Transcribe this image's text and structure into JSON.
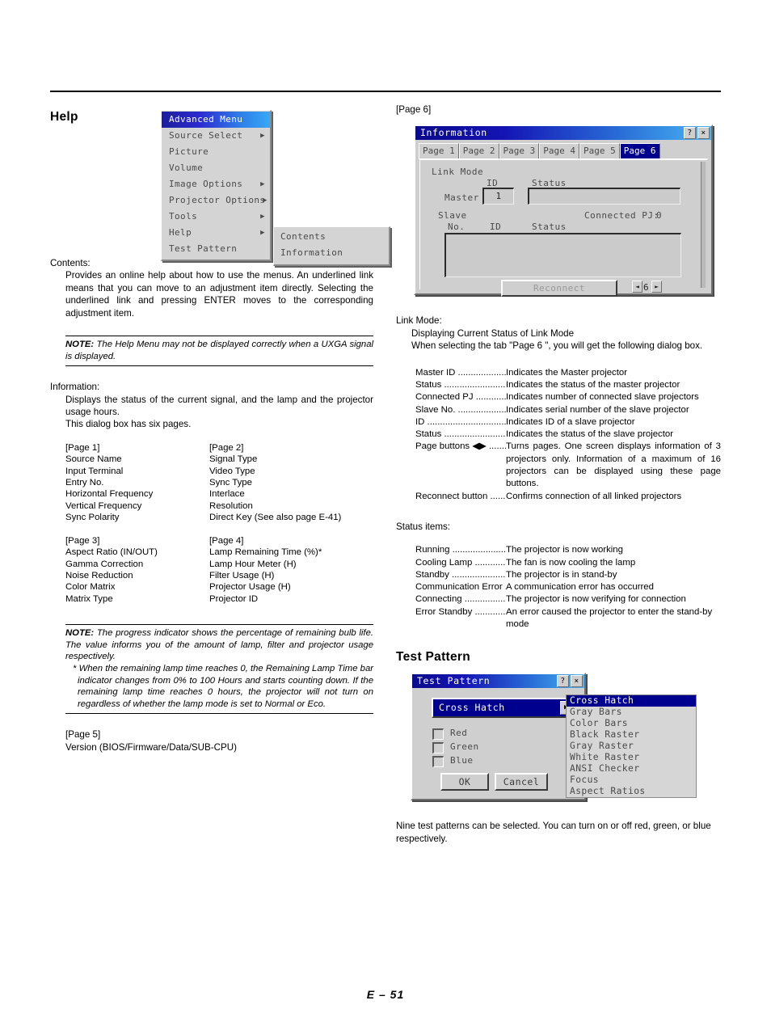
{
  "footer": {
    "page_label": "E – 51"
  },
  "left": {
    "heading": "Help",
    "help_menu": {
      "items": [
        {
          "label": "Advanced Menu",
          "arrow": "",
          "selected": true
        },
        {
          "label": "Source Select",
          "arrow": "▶",
          "selected": false
        },
        {
          "label": "Picture",
          "arrow": "",
          "selected": false
        },
        {
          "label": "Volume",
          "arrow": "",
          "selected": false
        },
        {
          "label": "Image Options",
          "arrow": "▶",
          "selected": false
        },
        {
          "label": "Projector Options",
          "arrow": "▶",
          "selected": false
        },
        {
          "label": "Tools",
          "arrow": "▶",
          "selected": false
        },
        {
          "label": "Help",
          "arrow": "▶",
          "selected": false
        },
        {
          "label": "Test Pattern",
          "arrow": "",
          "selected": false
        }
      ],
      "submenu": [
        {
          "label": "Contents"
        },
        {
          "label": "Information"
        }
      ]
    },
    "contents": {
      "title": "Contents:",
      "body": "Provides an online help about how to use the menus. An underlined link means that you can move to an adjustment item directly. Selecting the underlined link and pressing ENTER moves to the corresponding adjustment item."
    },
    "note1": {
      "label": "NOTE:",
      "text": " The Help Menu may not be displayed correctly when a UXGA signal is displayed."
    },
    "information": {
      "title": "Information:",
      "line1": "Displays the status of the current signal, and the lamp and the projector usage hours.",
      "line2": "This dialog box has six pages."
    },
    "page_lists": [
      {
        "left_title": "[Page 1]",
        "left_items": [
          "Source Name",
          "Input Terminal",
          "Entry No.",
          "Horizontal Frequency",
          "Vertical Frequency",
          "Sync Polarity"
        ],
        "right_title": "[Page 2]",
        "right_items": [
          "Signal Type",
          "Video Type",
          "Sync Type",
          "Interlace",
          "Resolution",
          "Direct Key (See also page E-41)"
        ]
      },
      {
        "left_title": "[Page 3]",
        "left_items": [
          "Aspect Ratio (IN/OUT)",
          "Gamma Correction",
          "Noise Reduction",
          "Color Matrix",
          "Matrix Type"
        ],
        "right_title": "[Page 4]",
        "right_items": [
          "Lamp Remaining Time (%)*",
          "Lamp Hour Meter (H)",
          "Filter Usage (H)",
          "Projector Usage (H)",
          "Projector ID"
        ]
      }
    ],
    "note2": {
      "label": "NOTE:",
      "text": " The progress indicator shows the percentage of remaining bulb life. The value informs you of the amount of lamp, filter and projector usage respectively.",
      "star": "* When the remaining lamp time reaches 0, the Remaining Lamp Time bar indicator changes from 0% to 100 Hours and starts counting down. If the remaining lamp time reaches 0 hours, the projector will not turn on regardless of whether the lamp mode is set to Normal or Eco."
    },
    "page5": {
      "title": "[Page 5]",
      "item": "Version (BIOS/Firmware/Data/SUB-CPU)"
    }
  },
  "right": {
    "page6_label": "[Page 6]",
    "information_dialog": {
      "title": "Information",
      "help_button": "?",
      "close_button": "×",
      "tabs": [
        {
          "label": "Page 1",
          "active": false
        },
        {
          "label": "Page 2",
          "active": false
        },
        {
          "label": "Page 3",
          "active": false
        },
        {
          "label": "Page 4",
          "active": false
        },
        {
          "label": "Page 5",
          "active": false
        },
        {
          "label": "Page 6",
          "active": true
        }
      ],
      "link_mode_label": "Link Mode",
      "id_header": "ID",
      "status_header": "Status",
      "master_label": "Master",
      "master_id_value": "1",
      "master_status_value": "",
      "slave_label": "Slave",
      "connected_pj_label": "Connected PJ:",
      "connected_pj_value": "0",
      "slave_no_header": "No.",
      "slave_id_header": "ID",
      "slave_status_header": "Status",
      "reconnect_button": "Reconnect",
      "page_prev": "◄",
      "page_number": "6",
      "page_next": "►"
    },
    "link_mode": {
      "title": "Link Mode:",
      "line1": "Displaying Current Status of Link Mode",
      "line2": "When selecting the tab \"Page 6 \", you will get the following dialog box.",
      "defs": [
        {
          "term": "Master ID ....................",
          "desc": "Indicates the Master projector"
        },
        {
          "term": "Status .........................",
          "desc": "Indicates the status of the master projector"
        },
        {
          "term": "Connected PJ ..............",
          "desc": "Indicates number of connected slave projectors"
        },
        {
          "term": "Slave No. ....................",
          "desc": "Indicates serial number of the slave projector"
        },
        {
          "term": "ID ................................",
          "desc": "Indicates ID of a slave projector"
        },
        {
          "term": "Status .........................",
          "desc": "Indicates the status of the slave projector"
        },
        {
          "term": "Page buttons ◀▶ ........",
          "desc": "Turns pages. One screen displays information of 3 projectors only. Information of a maximum of 16 projectors can be displayed using these page buttons."
        },
        {
          "term": "Reconnect button .......",
          "desc": "Confirms connection of all linked projectors"
        }
      ]
    },
    "status_items": {
      "title": "Status items:",
      "defs": [
        {
          "term": "Running ......................",
          "desc": "The projector is now working"
        },
        {
          "term": "Cooling Lamp .............",
          "desc": "The fan is now cooling the lamp"
        },
        {
          "term": "Standby .......................",
          "desc": "The projector is in stand-by"
        },
        {
          "term": "Communication Error .",
          "desc": "A communication error has occurred"
        },
        {
          "term": "Connecting ...................",
          "desc": "The projector is now verifying for connection"
        },
        {
          "term": "Error Standby .............",
          "desc": "An error caused the projector to enter the stand-by mode"
        }
      ]
    },
    "test_pattern": {
      "heading": "Test Pattern",
      "dialog": {
        "title": "Test Pattern",
        "help_button": "?",
        "close_button": "×",
        "selected_value": "Cross Hatch",
        "dropdown_arrow": "▶",
        "checkboxes": [
          {
            "label": "Red",
            "checked": false
          },
          {
            "label": "Green",
            "checked": false
          },
          {
            "label": "Blue",
            "checked": false
          }
        ],
        "ok_button": "OK",
        "cancel_button": "Cancel",
        "options": [
          {
            "label": "Cross Hatch",
            "selected": true
          },
          {
            "label": "Gray Bars",
            "selected": false
          },
          {
            "label": "Color Bars",
            "selected": false
          },
          {
            "label": "Black Raster",
            "selected": false
          },
          {
            "label": "Gray Raster",
            "selected": false
          },
          {
            "label": "White Raster",
            "selected": false
          },
          {
            "label": "ANSI Checker",
            "selected": false
          },
          {
            "label": "Focus",
            "selected": false
          },
          {
            "label": "Aspect Ratios",
            "selected": false
          }
        ]
      },
      "caption": "Nine test patterns can be selected. You can turn on or off red, green, or blue respectively."
    }
  }
}
